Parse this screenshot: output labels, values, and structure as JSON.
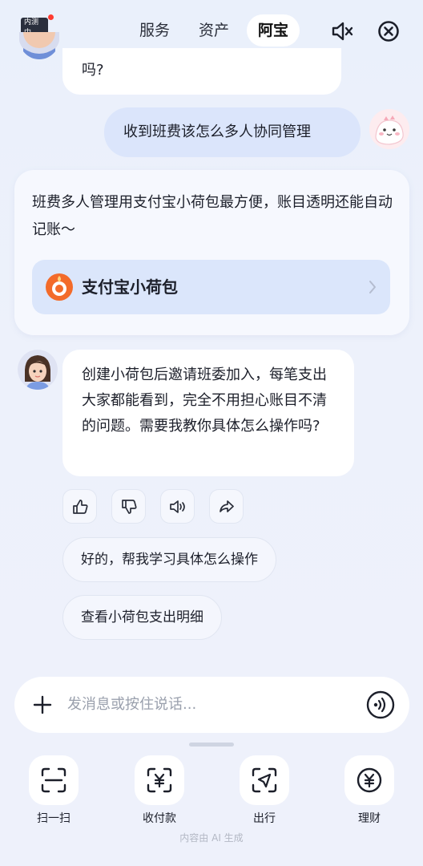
{
  "header": {
    "beta_badge": "内测中",
    "tabs": [
      {
        "label": "服务",
        "active": false
      },
      {
        "label": "资产",
        "active": false
      },
      {
        "label": "阿宝",
        "active": true
      }
    ],
    "mute_icon": "speaker-mute-icon",
    "close_icon": "close-circle-icon"
  },
  "messages": {
    "prev_ai_tail": "吗?",
    "user_message": "收到班费该怎么多人协同管理",
    "card": {
      "text": "班费多人管理用支付宝小荷包最方便，账目透明还能自动记账～",
      "link_label": "支付宝小荷包"
    },
    "ai_reply": "创建小荷包后邀请班委加入，每笔支出大家都能看到，完全不用担心账目不清的问题。需要我教你具体怎么操作吗?"
  },
  "actions": [
    "thumbs-up-icon",
    "thumbs-down-icon",
    "speaker-icon",
    "share-icon"
  ],
  "suggestions": [
    "好的，帮我学习具体怎么操作",
    "查看小荷包支出明细"
  ],
  "input": {
    "placeholder": "发消息或按住说话..."
  },
  "shortcuts": [
    {
      "label": "扫一扫",
      "icon": "scan-icon"
    },
    {
      "label": "收付款",
      "icon": "payment-code-icon"
    },
    {
      "label": "出行",
      "icon": "navigation-icon"
    },
    {
      "label": "理财",
      "icon": "yuan-icon"
    }
  ],
  "footnote": "内容由 AI 生成",
  "colors": {
    "accent_bubble": "#dbe5fb",
    "brand_orange": "#f36b2a"
  }
}
